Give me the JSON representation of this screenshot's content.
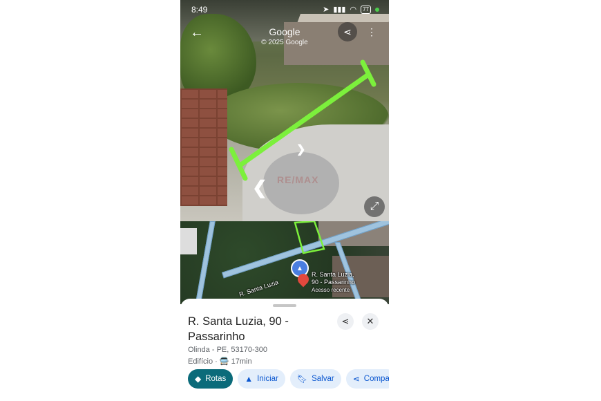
{
  "status": {
    "time": "8:49",
    "battery": "77"
  },
  "streetview": {
    "title": "Google",
    "subtitle": "© 2025 Google",
    "watermark": "RE/MAX"
  },
  "map": {
    "street_label": "R. Santa Luzia",
    "pin_label_line1": "R. Santa Luzia,",
    "pin_label_line2": "90 - Passarinho",
    "pin_label_line3": "Acesso recente"
  },
  "place": {
    "title_line1": "R. Santa Luzia, 90 -",
    "title_line2": "Passarinho",
    "address": "Olinda - PE, 53170-300",
    "type": "Edifício",
    "transit_time": "17min"
  },
  "actions": [
    {
      "label": "Rotas",
      "icon": "directions-icon"
    },
    {
      "label": "Iniciar",
      "icon": "navigation-arrow-icon"
    },
    {
      "label": "Salvar",
      "icon": "bookmark-icon"
    },
    {
      "label": "Compa",
      "icon": "share-icon"
    }
  ],
  "colors": {
    "primary_chip": "#0b6b7a",
    "chip_bg": "#e3eefb",
    "highlight": "#7cf03c"
  }
}
